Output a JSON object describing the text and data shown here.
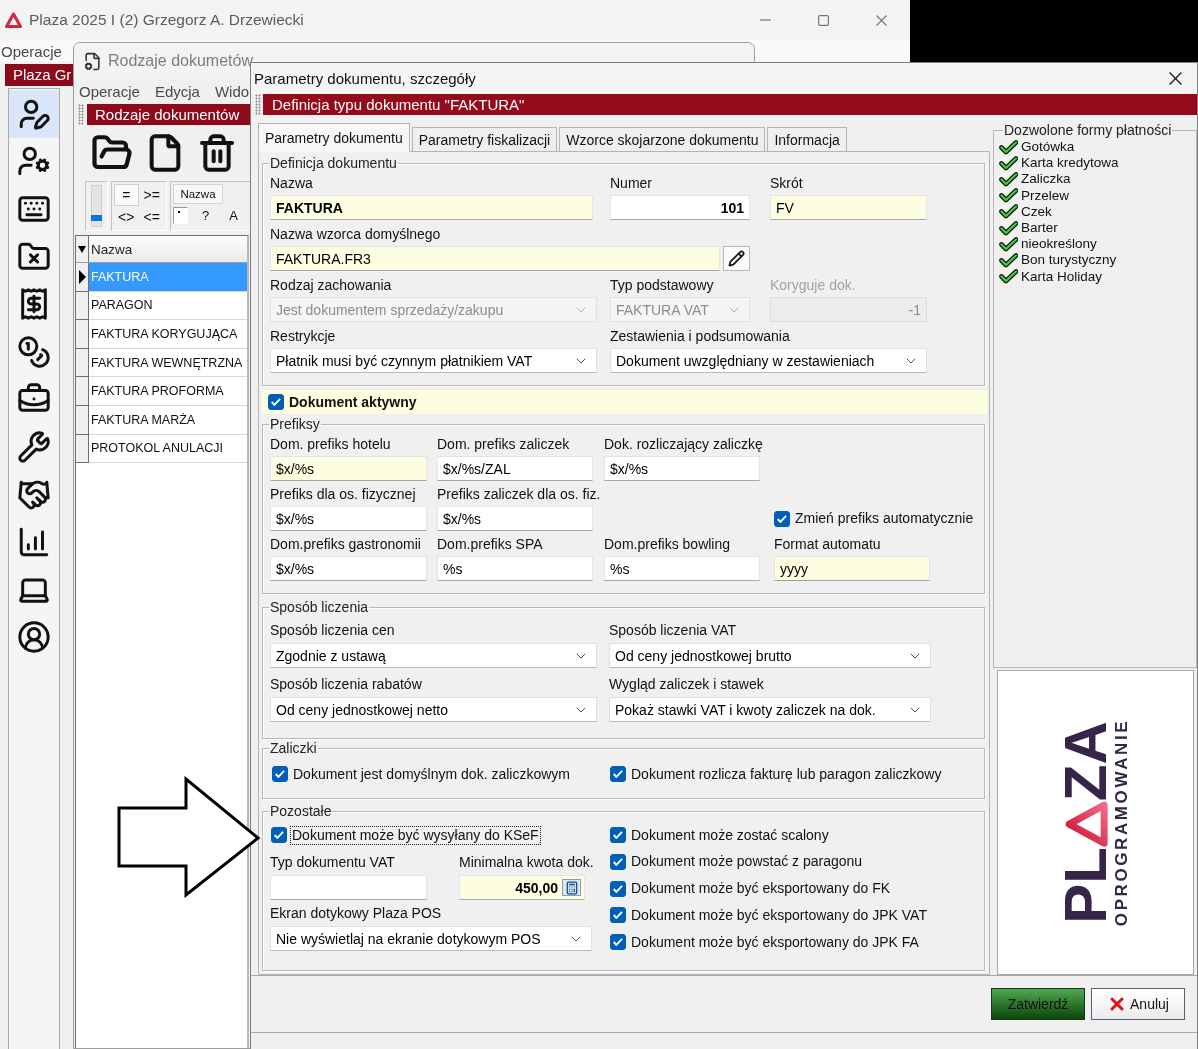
{
  "main_window": {
    "title": "Plaza 2025 I (2) Grzegorz A. Drzewiecki",
    "menu": [
      "Operacje"
    ],
    "banner": "Plaza Gr",
    "sidebar": {
      "items": [
        {
          "selected": true
        },
        {
          "selected": false
        },
        {
          "selected": false
        },
        {
          "selected": false
        },
        {
          "selected": false
        },
        {
          "selected": false
        },
        {
          "selected": false
        },
        {
          "selected": false
        },
        {
          "selected": false
        },
        {
          "selected": false
        },
        {
          "selected": false
        },
        {
          "selected": false
        }
      ]
    }
  },
  "list_window": {
    "title": "Rodzaje dokumetów",
    "menu": [
      "Operacje",
      "Edycja",
      "Wido"
    ],
    "banner": "Rodzaje dokumentów",
    "filter": {
      "slider": {
        "level": 0.15
      },
      "operators": [
        {
          "label": "=",
          "selected": true
        },
        {
          "label": ">=",
          "selected": false
        },
        {
          "label": "<>",
          "selected": false
        },
        {
          "label": "<=",
          "selected": false
        }
      ],
      "column_tab": "Nazwa",
      "buttons": [
        "?",
        "A"
      ]
    },
    "grid": {
      "column": "Nazwa",
      "rows": [
        {
          "name": "FAKTURA",
          "selected": true
        },
        {
          "name": "PARAGON",
          "selected": false
        },
        {
          "name": "FAKTURA KORYGUJĄCA",
          "selected": false
        },
        {
          "name": "FAKTURA WEWNĘTRZNA",
          "selected": false
        },
        {
          "name": "FAKTURA PROFORMA",
          "selected": false
        },
        {
          "name": "FAKTURA MARŻA",
          "selected": false
        },
        {
          "name": "PROTOKOL ANULACJI",
          "selected": false
        }
      ]
    }
  },
  "dialog": {
    "title": "Parametry dokumentu, szczegóły",
    "header": "Definicja typu dokumentu \"FAKTURA\"",
    "tabs": [
      {
        "label": "Parametry dokumentu",
        "selected": true
      },
      {
        "label": "Parametry fiskalizacji",
        "selected": false
      },
      {
        "label": "Wzorce skojarzone dokumentu",
        "selected": false
      },
      {
        "label": "Informacja",
        "selected": false
      }
    ],
    "definition": {
      "legend": "Definicja dokumentu",
      "fields": [
        {
          "kind": "text",
          "label": "Nazwa",
          "value": "FAKTURA",
          "highlighted": true,
          "disabled": false
        },
        {
          "kind": "text",
          "label": "Numer",
          "value": "101",
          "highlighted": false,
          "disabled": false
        },
        {
          "kind": "text",
          "label": "Skrót",
          "value": "FV",
          "highlighted": true,
          "disabled": false
        },
        {
          "kind": "text_edit",
          "label": "Nazwa wzorca domyślnego",
          "value": "FAKTURA.FR3",
          "highlighted": true,
          "disabled": false
        },
        {
          "kind": "select",
          "label": "Rodzaj zachowania",
          "value": "Jest dokumentem sprzedaży/zakupu",
          "highlighted": false,
          "disabled": true
        },
        {
          "kind": "select",
          "label": "Typ podstawowy",
          "value": "FAKTURA VAT",
          "highlighted": false,
          "disabled": true
        },
        {
          "kind": "text",
          "label": "Koryguje dok.",
          "value": "-1",
          "highlighted": false,
          "disabled": true
        },
        {
          "kind": "select",
          "label": "Restrykcje",
          "value": "Płatnik musi być czynnym płatnikiem VAT",
          "highlighted": false,
          "disabled": false
        },
        {
          "kind": "select",
          "label": "Zestawienia i podsumowania",
          "value": "Dokument uwzględniany w zestawieniach",
          "highlighted": false,
          "disabled": false
        }
      ]
    },
    "active": {
      "label": "Dokument aktywny",
      "checked": true
    },
    "prefixes": {
      "legend": "Prefiksy",
      "fields": [
        {
          "kind": "text",
          "label": "Dom. prefiks hotelu",
          "value": "$x/%s",
          "highlighted": true,
          "disabled": false
        },
        {
          "kind": "text",
          "label": "Dom. prefiks zaliczek",
          "value": "$x/%s/ZAL",
          "highlighted": false,
          "disabled": false
        },
        {
          "kind": "text",
          "label": "Dok. rozliczający zaliczkę",
          "value": "$x/%s",
          "highlighted": false,
          "disabled": false
        },
        {
          "kind": "text",
          "label": "Prefiks dla os. fizycznej",
          "value": "$x/%s",
          "highlighted": false,
          "disabled": false
        },
        {
          "kind": "text",
          "label": "Prefiks zaliczek dla os. fiz.",
          "value": "$x/%s",
          "highlighted": false,
          "disabled": false
        },
        {
          "kind": "checkbox",
          "label": "Zmień prefiks automatycznie",
          "checked": true,
          "focused": false
        },
        {
          "kind": "text",
          "label": "Dom.prefiks gastronomii",
          "value": "$x/%s",
          "highlighted": false,
          "disabled": false
        },
        {
          "kind": "text",
          "label": "Dom.prefiks SPA",
          "value": "%s",
          "highlighted": false,
          "disabled": false
        },
        {
          "kind": "text",
          "label": "Dom.prefiks bowling",
          "value": "%s",
          "highlighted": false,
          "disabled": false
        },
        {
          "kind": "text",
          "label": "Format automatu",
          "value": "yyyy",
          "highlighted": true,
          "disabled": false
        }
      ]
    },
    "calculation": {
      "legend": "Sposób liczenia",
      "fields": [
        {
          "kind": "select",
          "label": "Sposób liczenia cen",
          "value": "Zgodnie z ustawą",
          "highlighted": false,
          "disabled": false
        },
        {
          "kind": "select",
          "label": "Sposób liczenia VAT",
          "value": "Od ceny jednostkowej brutto",
          "highlighted": false,
          "disabled": false
        },
        {
          "kind": "select",
          "label": "Sposób liczenia rabatów",
          "value": "Od ceny jednostkowej netto",
          "highlighted": false,
          "disabled": false
        },
        {
          "kind": "select",
          "label": "Wygląd zaliczek i stawek",
          "value": "Pokaż stawki VAT i kwoty zaliczek na dok.",
          "highlighted": false,
          "disabled": false
        }
      ]
    },
    "advances": {
      "legend": "Zaliczki",
      "fields": [
        {
          "kind": "checkbox",
          "label": "Dokument jest domyślnym dok. zaliczkowym",
          "checked": true,
          "focused": false
        },
        {
          "kind": "checkbox",
          "label": "Dokument rozlicza fakturę lub paragon zaliczkowy",
          "checked": true,
          "focused": false
        }
      ]
    },
    "other": {
      "legend": "Pozostałe",
      "fields": [
        {
          "kind": "checkbox",
          "label": "Dokument może być wysyłany do KSeF",
          "checked": true,
          "focused": true
        },
        {
          "kind": "text",
          "label": "Typ dokumentu VAT",
          "highlighted": false,
          "disabled": false
        },
        {
          "kind": "amount",
          "label": "Minimalna kwota dok.",
          "value": "450,00",
          "highlighted": true,
          "disabled": false
        },
        {
          "kind": "select",
          "label": "Ekran dotykowy Plaza POS",
          "value": "Nie wyświetlaj na ekranie dotykowym POS",
          "highlighted": false,
          "disabled": false
        },
        {
          "kind": "checkbox",
          "label": "Dokument może zostać scalony",
          "checked": true,
          "focused": false
        },
        {
          "kind": "checkbox",
          "label": "Dokument może powstać z paragonu",
          "checked": true,
          "focused": false
        },
        {
          "kind": "checkbox",
          "label": "Dokument może być eksportowany do FK",
          "checked": true,
          "focused": false
        },
        {
          "kind": "checkbox",
          "label": "Dokument może być eksportowany do JPK VAT",
          "checked": true,
          "focused": false
        },
        {
          "kind": "checkbox",
          "label": "Dokument może być eksportowany do JPK FA",
          "checked": true,
          "focused": false
        }
      ]
    },
    "payments": {
      "legend": "Dozwolone formy płatności",
      "items": [
        {
          "label": "Gotówka",
          "checked": true
        },
        {
          "label": "Karta kredytowa",
          "checked": true
        },
        {
          "label": "Zaliczka",
          "checked": true
        },
        {
          "label": "Przelew",
          "checked": true
        },
        {
          "label": "Czek",
          "checked": true
        },
        {
          "label": "Barter",
          "checked": true
        },
        {
          "label": "nieokreślony",
          "checked": true
        },
        {
          "label": "Bon turystyczny",
          "checked": true
        },
        {
          "label": "Karta Holiday",
          "checked": true
        }
      ]
    },
    "logo": {
      "left": "PL",
      "right": "ZA",
      "tagline": "OPROGRAMOWANIE"
    },
    "buttons": [
      {
        "kind": "confirm",
        "label": "Zatwierdź"
      },
      {
        "kind": "cancel",
        "label": "Anuluj"
      }
    ]
  }
}
